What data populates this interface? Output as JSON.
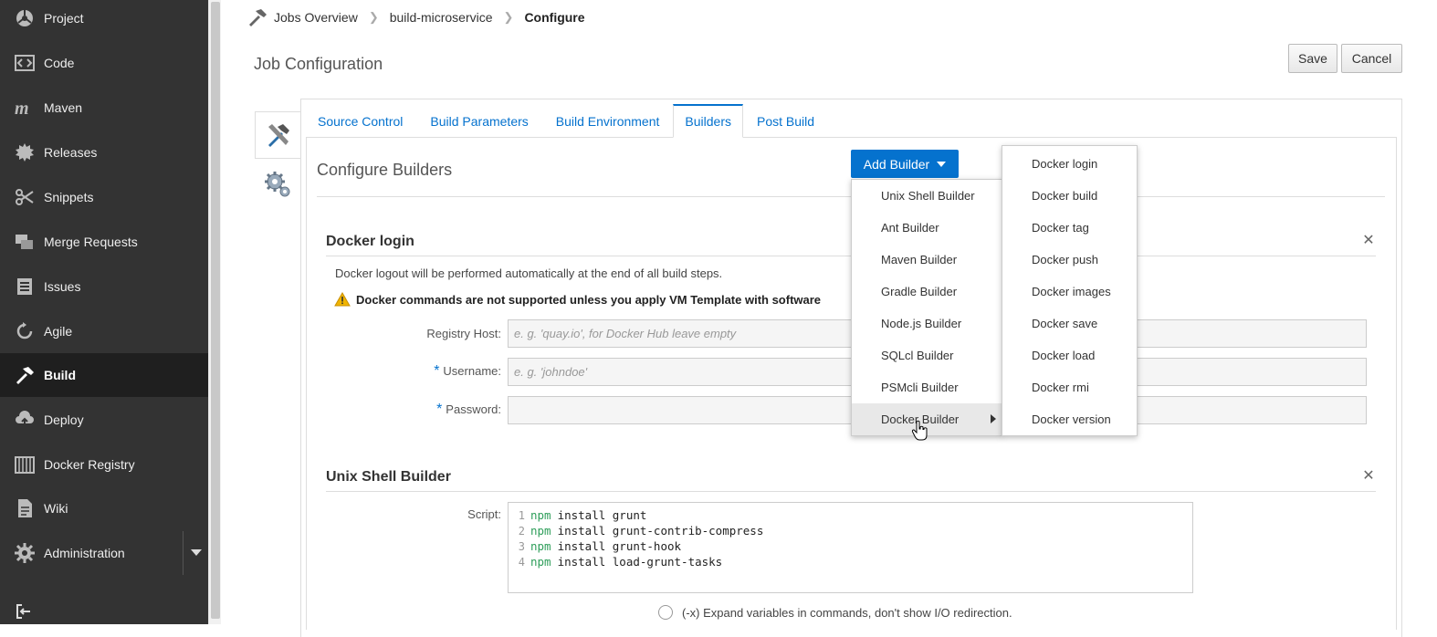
{
  "sidebar": {
    "items": [
      {
        "label": "Project",
        "icon": "project-icon"
      },
      {
        "label": "Code",
        "icon": "code-icon"
      },
      {
        "label": "Maven",
        "icon": "maven-icon"
      },
      {
        "label": "Releases",
        "icon": "releases-icon"
      },
      {
        "label": "Snippets",
        "icon": "snippets-icon"
      },
      {
        "label": "Merge Requests",
        "icon": "merge-requests-icon"
      },
      {
        "label": "Issues",
        "icon": "issues-icon"
      },
      {
        "label": "Agile",
        "icon": "agile-icon"
      },
      {
        "label": "Build",
        "icon": "build-icon",
        "active": true
      },
      {
        "label": "Deploy",
        "icon": "deploy-icon"
      },
      {
        "label": "Docker Registry",
        "icon": "docker-registry-icon"
      },
      {
        "label": "Wiki",
        "icon": "wiki-icon"
      },
      {
        "label": "Administration",
        "icon": "administration-icon"
      }
    ]
  },
  "breadcrumb": {
    "items": [
      "Jobs Overview",
      "build-microservice"
    ],
    "current": "Configure"
  },
  "header": {
    "title": "Job Configuration",
    "save_label": "Save",
    "cancel_label": "Cancel"
  },
  "tabs": [
    "Source Control",
    "Build Parameters",
    "Build Environment",
    "Builders",
    "Post Build"
  ],
  "active_tab": "Builders",
  "builders": {
    "title": "Configure Builders",
    "add_label": "Add Builder"
  },
  "docker_login": {
    "title": "Docker login",
    "note": "Docker logout will be performed automatically at the end of all build steps.",
    "warning": "Docker commands are not supported unless you apply VM Template with software",
    "registry_label": "Registry Host:",
    "registry_placeholder": "e. g. 'quay.io', for Docker Hub leave empty",
    "username_label": "Username:",
    "username_placeholder": "e. g. 'johndoe'",
    "password_label": "Password:",
    "required_mark": "*"
  },
  "unix_shell": {
    "title": "Unix Shell Builder",
    "script_label": "Script:",
    "lines": [
      {
        "n": "1",
        "kw": "npm",
        "rest": "install grunt"
      },
      {
        "n": "2",
        "kw": "npm",
        "rest": "install grunt-contrib-compress"
      },
      {
        "n": "3",
        "kw": "npm",
        "rest": "install grunt-hook"
      },
      {
        "n": "4",
        "kw": "npm",
        "rest": "install load-grunt-tasks"
      }
    ],
    "option_label": "(-x) Expand variables in commands, don't show I/O redirection."
  },
  "add_menu": [
    "Unix Shell Builder",
    "Ant Builder",
    "Maven Builder",
    "Gradle Builder",
    "Node.js Builder",
    "SQLcl Builder",
    "PSMcli Builder",
    "Docker Builder"
  ],
  "docker_menu": [
    "Docker login",
    "Docker build",
    "Docker tag",
    "Docker push",
    "Docker images",
    "Docker save",
    "Docker load",
    "Docker rmi",
    "Docker version"
  ],
  "colors": {
    "sidebar_bg": "#333333",
    "sidebar_active": "#1f1f1f",
    "accent": "#0572ce",
    "npm_keyword": "#2e9e5a",
    "warning": "#f0b400"
  }
}
